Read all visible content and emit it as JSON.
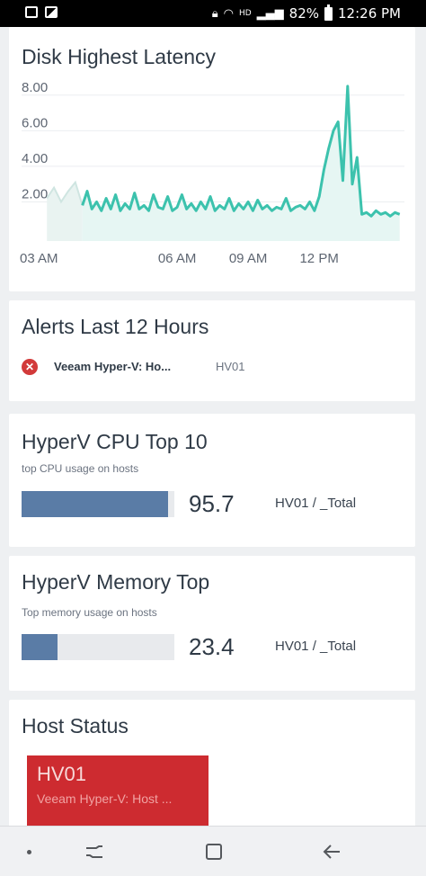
{
  "status_bar": {
    "battery": "82%",
    "time": "12:26 PM",
    "left_icons": [
      "notes-icon",
      "image-icon"
    ],
    "right_icons": [
      "lock-icon",
      "wifi-icon",
      "hd-icon",
      "signal-icon",
      "battery-icon"
    ]
  },
  "latency_card": {
    "title": "Disk Highest Latency"
  },
  "chart_data": {
    "type": "area",
    "title": "Disk Highest Latency",
    "ylim": [
      0,
      9
    ],
    "y_ticks": [
      "8.00",
      "6.00",
      "4.00",
      "2.00"
    ],
    "x_ticks": [
      "03 AM",
      "06 AM",
      "09 AM",
      "12 PM"
    ],
    "x_hours": [
      0.5,
      3.5,
      6.5,
      9.5,
      12.5,
      15.5
    ],
    "x_tick_hours": [
      3,
      6,
      9,
      12
    ],
    "grid": true,
    "color": "#3cc2ad",
    "series": [
      {
        "x": [
          2.0,
          2.2,
          2.4,
          2.6,
          2.8,
          3.0,
          3.2,
          3.4,
          3.6,
          3.8,
          4.0,
          4.2,
          4.4,
          4.6,
          4.8,
          5.0,
          5.2,
          5.4,
          5.6,
          5.8,
          6.0,
          6.2,
          6.4,
          6.6,
          6.8,
          7.0,
          7.2,
          7.4,
          7.6,
          7.8,
          8.0,
          8.2,
          8.4,
          8.6,
          8.8,
          9.0,
          9.2,
          9.4,
          9.6,
          9.8,
          10.0,
          10.2,
          10.4,
          10.6,
          10.8,
          11.0,
          11.2,
          11.4,
          11.6,
          11.8,
          12.0,
          12.2,
          12.4,
          12.6,
          12.8,
          13.0,
          13.2,
          13.4,
          13.6,
          13.8,
          14.0,
          14.2,
          14.4,
          14.6,
          14.8,
          15.0,
          15.2,
          15.4
        ],
        "y": [
          1.8,
          2.6,
          1.6,
          2.0,
          1.5,
          2.2,
          1.6,
          2.4,
          1.5,
          1.9,
          1.6,
          2.5,
          1.6,
          1.8,
          1.5,
          2.4,
          1.7,
          1.6,
          2.3,
          1.5,
          1.7,
          2.4,
          1.6,
          1.9,
          1.5,
          2.0,
          1.6,
          2.3,
          1.5,
          1.8,
          1.6,
          2.2,
          1.5,
          1.9,
          1.6,
          2.0,
          1.5,
          2.1,
          1.6,
          1.8,
          1.5,
          1.7,
          1.6,
          2.2,
          1.5,
          1.7,
          1.8,
          1.6,
          2.0,
          1.5,
          2.3,
          3.8,
          5.0,
          6.0,
          6.5,
          3.2,
          8.5,
          3.0,
          4.5,
          1.3,
          1.4,
          1.2,
          1.5,
          1.3,
          1.4,
          1.2,
          1.4,
          1.3
        ]
      }
    ],
    "background_series": {
      "x": [
        0.5,
        0.8,
        1.1,
        1.4,
        1.7,
        2.0
      ],
      "y": [
        2.2,
        2.8,
        2.0,
        2.6,
        3.1,
        1.8
      ]
    }
  },
  "alerts_card": {
    "title": "Alerts Last 12 Hours",
    "items": [
      {
        "icon": "error-circle-icon",
        "name": "Veeam Hyper-V: Ho...",
        "host": "HV01"
      }
    ]
  },
  "cpu_card": {
    "title": "HyperV CPU Top 10",
    "subtitle": "top CPU usage on hosts",
    "value": "95.7",
    "fraction": 0.957,
    "label": "HV01 / _Total",
    "bar_color": "#5a7ca6"
  },
  "mem_card": {
    "title": "HyperV Memory Top",
    "subtitle": "Top memory usage on hosts",
    "value": "23.4",
    "fraction": 0.234,
    "label": "HV01 / _Total",
    "bar_color": "#5a7ca6"
  },
  "host_card": {
    "title": "Host Status",
    "tile": {
      "name": "HV01",
      "subtitle": "Veeam Hyper-V: Host ...",
      "color": "#cd2b30"
    }
  },
  "nav_bar": {
    "icons": [
      "dot-icon",
      "recent-apps-icon",
      "home-icon",
      "back-icon"
    ]
  }
}
